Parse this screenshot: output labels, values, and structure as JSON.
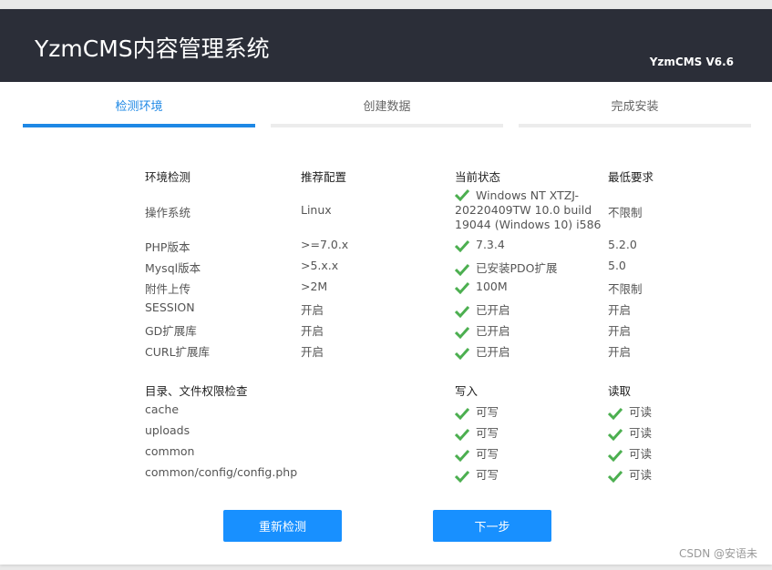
{
  "header": {
    "title": "YzmCMS内容管理系统",
    "version": "YzmCMS V6.6"
  },
  "steps": [
    {
      "label": "检测环境"
    },
    {
      "label": "创建数据"
    },
    {
      "label": "完成安装"
    }
  ],
  "env": {
    "headers": [
      "环境检测",
      "推荐配置",
      "当前状态",
      "最低要求"
    ],
    "rows": [
      {
        "name": "操作系统",
        "recommend": "Linux",
        "current": "Windows NT XTZJ-20220409TW 10.0 build 19044 (Windows 10) i586",
        "min": "不限制"
      },
      {
        "name": "PHP版本",
        "recommend": ">=7.0.x",
        "current": "7.3.4",
        "min": "5.2.0"
      },
      {
        "name": "Mysql版本",
        "recommend": ">5.x.x",
        "current": "已安装PDO扩展",
        "min": "5.0"
      },
      {
        "name": "附件上传",
        "recommend": ">2M",
        "current": "100M",
        "min": "不限制"
      },
      {
        "name": "SESSION",
        "recommend": "开启",
        "current": "已开启",
        "min": "开启"
      },
      {
        "name": "GD扩展库",
        "recommend": "开启",
        "current": "已开启",
        "min": "开启"
      },
      {
        "name": "CURL扩展库",
        "recommend": "开启",
        "current": "已开启",
        "min": "开启"
      }
    ]
  },
  "perm": {
    "headers": [
      "目录、文件权限检查",
      "写入",
      "读取"
    ],
    "rows": [
      {
        "path": "cache",
        "write": "可写",
        "read": "可读"
      },
      {
        "path": "uploads",
        "write": "可写",
        "read": "可读"
      },
      {
        "path": "common",
        "write": "可写",
        "read": "可读"
      },
      {
        "path": "common/config/config.php",
        "write": "可写",
        "read": "可读"
      }
    ]
  },
  "buttons": {
    "recheck": "重新检测",
    "next": "下一步"
  },
  "watermark": "CSDN @安语未",
  "colors": {
    "accent": "#1890ff",
    "check": "#4caf50",
    "header_bg": "#2b2e38"
  }
}
